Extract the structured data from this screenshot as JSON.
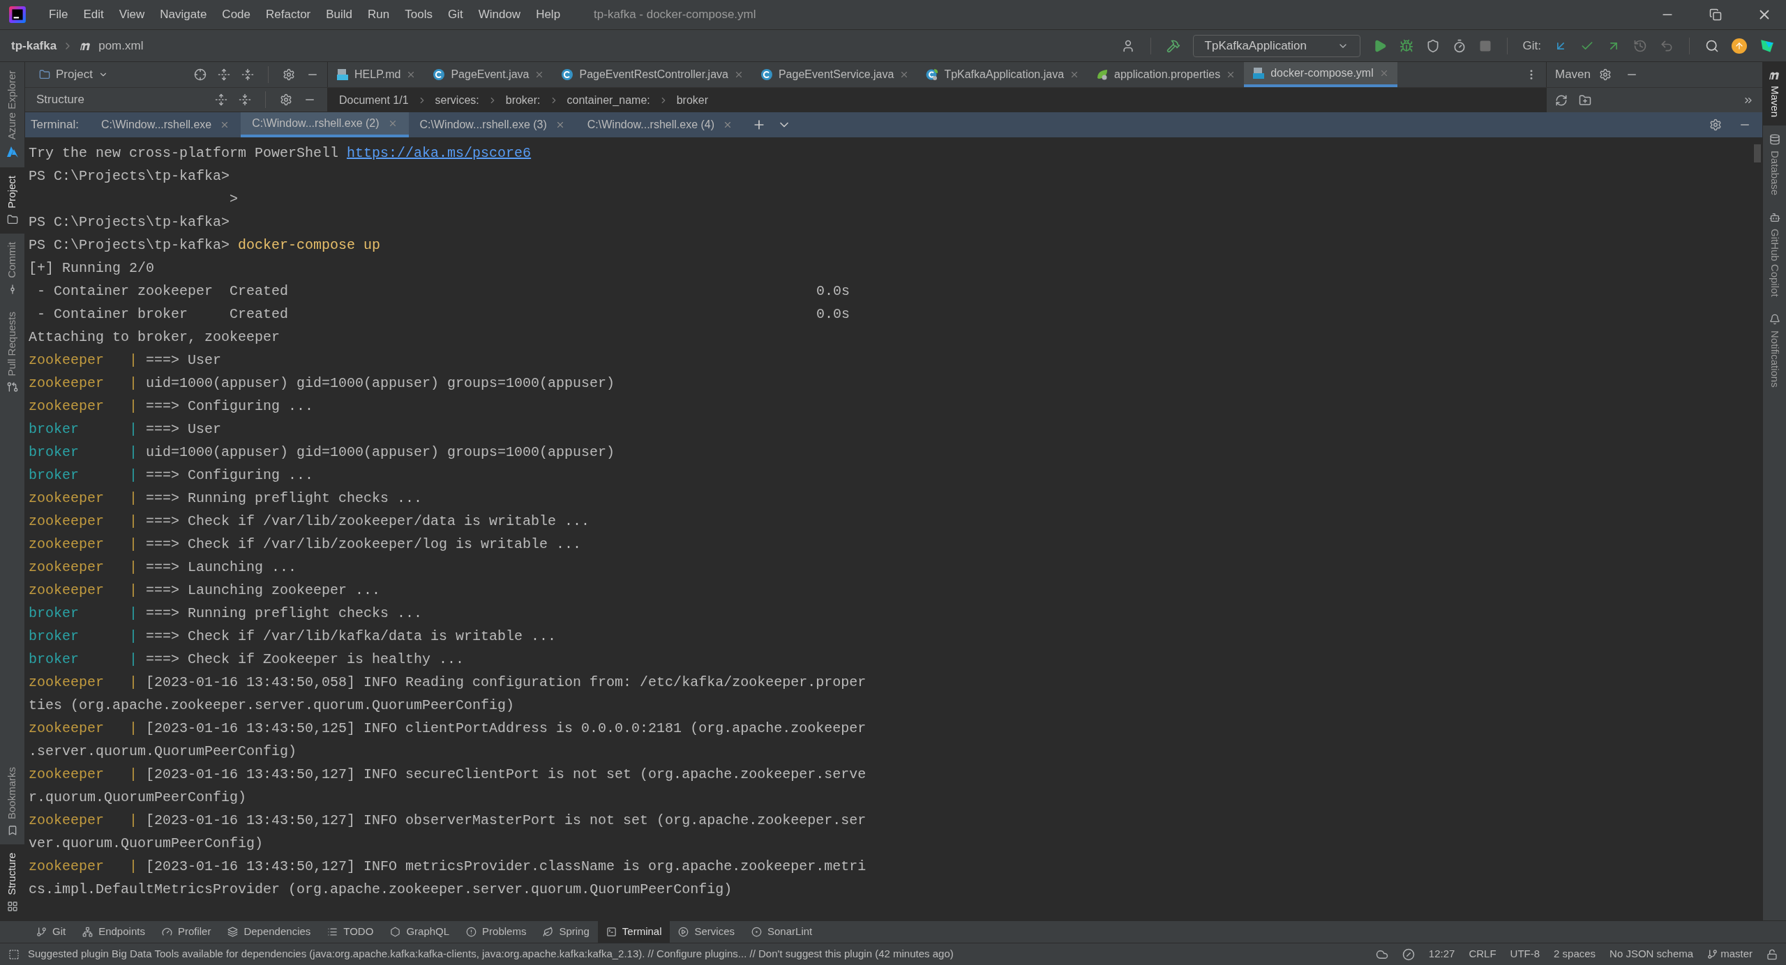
{
  "title_bar": {
    "menus": [
      "File",
      "Edit",
      "View",
      "Navigate",
      "Code",
      "Refactor",
      "Build",
      "Run",
      "Tools",
      "Git",
      "Window",
      "Help"
    ],
    "title": "tp-kafka - docker-compose.yml"
  },
  "nav_bar": {
    "project": "tp-kafka",
    "file": "pom.xml",
    "run_config": "TpKafkaApplication",
    "git_label": "Git:"
  },
  "left_panel": {
    "project_label": "Project",
    "structure_label": "Structure"
  },
  "editor_tabs": [
    {
      "label": "HELP.md",
      "kind": "markdown",
      "selected": false
    },
    {
      "label": "PageEvent.java",
      "kind": "class",
      "selected": false
    },
    {
      "label": "PageEventRestController.java",
      "kind": "class",
      "selected": false
    },
    {
      "label": "PageEventService.java",
      "kind": "class",
      "selected": false
    },
    {
      "label": "TpKafkaApplication.java",
      "kind": "application",
      "selected": false
    },
    {
      "label": "application.properties",
      "kind": "properties",
      "selected": false
    },
    {
      "label": "docker-compose.yml",
      "kind": "compose",
      "selected": true
    }
  ],
  "breadcrumbs": [
    "Document 1/1",
    "services:",
    "broker:",
    "container_name:",
    "broker"
  ],
  "maven": {
    "label": "Maven"
  },
  "terminal": {
    "label": "Terminal:",
    "tabs": [
      {
        "label": "C:\\Window...rshell.exe",
        "selected": false
      },
      {
        "label": "C:\\Window...rshell.exe (2)",
        "selected": true
      },
      {
        "label": "C:\\Window...rshell.exe (3)",
        "selected": false
      },
      {
        "label": "C:\\Window...rshell.exe (4)",
        "selected": false
      }
    ],
    "lines": [
      {
        "kind": "link",
        "text": "Try the new cross-platform PowerShell ",
        "link": "https://aka.ms/pscore6"
      },
      {
        "kind": "plain",
        "text": "PS C:\\Projects\\tp-kafka>"
      },
      {
        "kind": "indent",
        "text": ">"
      },
      {
        "kind": "plain",
        "text": "PS C:\\Projects\\tp-kafka>"
      },
      {
        "kind": "command",
        "text": "PS C:\\Projects\\tp-kafka> ",
        "command": "docker-compose up"
      },
      {
        "kind": "plain",
        "text": "[+] Running 2/0"
      },
      {
        "kind": "status",
        "text": "- Container zookeeper",
        "status": "Created",
        "time": "0.0s"
      },
      {
        "kind": "status",
        "text": "- Container broker",
        "status": "Created",
        "time": "0.0s"
      },
      {
        "kind": "plain",
        "text": "Attaching to broker, zookeeper"
      },
      {
        "kind": "log",
        "service": "zookeeper",
        "color": "#c29b3f",
        "sep": "|",
        "text": "===> User"
      },
      {
        "kind": "log",
        "service": "zookeeper",
        "color": "#c29b3f",
        "sep": "|",
        "text": "uid=1000(appuser) gid=1000(appuser) groups=1000(appuser)"
      },
      {
        "kind": "log",
        "service": "zookeeper",
        "color": "#c29b3f",
        "sep": "|",
        "text": "===> Configuring ..."
      },
      {
        "kind": "log",
        "service": "broker",
        "color": "#2aa3a6",
        "sep": "|",
        "text": "===> User"
      },
      {
        "kind": "log",
        "service": "broker",
        "color": "#2aa3a6",
        "sep": "|",
        "text": "uid=1000(appuser) gid=1000(appuser) groups=1000(appuser)"
      },
      {
        "kind": "log",
        "service": "broker",
        "color": "#2aa3a6",
        "sep": "|",
        "text": "===> Configuring ..."
      },
      {
        "kind": "log",
        "service": "zookeeper",
        "color": "#c29b3f",
        "sep": "|",
        "text": "===> Running preflight checks ..."
      },
      {
        "kind": "log",
        "service": "zookeeper",
        "color": "#c29b3f",
        "sep": "|",
        "text": "===> Check if /var/lib/zookeeper/data is writable ..."
      },
      {
        "kind": "log",
        "service": "zookeeper",
        "color": "#c29b3f",
        "sep": "|",
        "text": "===> Check if /var/lib/zookeeper/log is writable ..."
      },
      {
        "kind": "log",
        "service": "zookeeper",
        "color": "#c29b3f",
        "sep": "|",
        "text": "===> Launching ..."
      },
      {
        "kind": "log",
        "service": "zookeeper",
        "color": "#c29b3f",
        "sep": "|",
        "text": "===> Launching zookeeper ..."
      },
      {
        "kind": "log",
        "service": "broker",
        "color": "#2aa3a6",
        "sep": "|",
        "text": "===> Running preflight checks ..."
      },
      {
        "kind": "log",
        "service": "broker",
        "color": "#2aa3a6",
        "sep": "|",
        "text": "===> Check if /var/lib/kafka/data is writable ..."
      },
      {
        "kind": "log",
        "service": "broker",
        "color": "#2aa3a6",
        "sep": "|",
        "text": "===> Check if Zookeeper is healthy ..."
      },
      {
        "kind": "log",
        "service": "zookeeper",
        "color": "#c29b3f",
        "sep": "|",
        "text": "[2023-01-16 13:43:50,058] INFO Reading configuration from: /etc/kafka/zookeeper.proper"
      },
      {
        "kind": "plain",
        "text": "ties (org.apache.zookeeper.server.quorum.QuorumPeerConfig)"
      },
      {
        "kind": "log",
        "service": "zookeeper",
        "color": "#c29b3f",
        "sep": "|",
        "text": "[2023-01-16 13:43:50,125] INFO clientPortAddress is 0.0.0.0:2181 (org.apache.zookeeper"
      },
      {
        "kind": "plain",
        "text": ".server.quorum.QuorumPeerConfig)"
      },
      {
        "kind": "log",
        "service": "zookeeper",
        "color": "#c29b3f",
        "sep": "|",
        "text": "[2023-01-16 13:43:50,127] INFO secureClientPort is not set (org.apache.zookeeper.serve"
      },
      {
        "kind": "plain",
        "text": "r.quorum.QuorumPeerConfig)"
      },
      {
        "kind": "log",
        "service": "zookeeper",
        "color": "#c29b3f",
        "sep": "|",
        "text": "[2023-01-16 13:43:50,127] INFO observerMasterPort is not set (org.apache.zookeeper.ser"
      },
      {
        "kind": "plain",
        "text": "ver.quorum.QuorumPeerConfig)"
      },
      {
        "kind": "log",
        "service": "zookeeper",
        "color": "#c29b3f",
        "sep": "|",
        "text": "[2023-01-16 13:43:50,127] INFO metricsProvider.className is org.apache.zookeeper.metri"
      },
      {
        "kind": "plain",
        "text": "cs.impl.DefaultMetricsProvider (org.apache.zookeeper.server.quorum.QuorumPeerConfig)"
      }
    ]
  },
  "left_strip_top": [
    {
      "label": "Azure Explorer",
      "kind": "azure",
      "selected": false
    },
    {
      "label": "Project",
      "kind": "project",
      "selected": true
    },
    {
      "label": "Commit",
      "kind": "commit",
      "selected": false
    },
    {
      "label": "Pull Requests",
      "kind": "pull",
      "selected": false
    }
  ],
  "left_strip_bottom": [
    {
      "label": "Bookmarks",
      "kind": "bookmarks",
      "selected": false
    },
    {
      "label": "Structure",
      "kind": "structure",
      "selected": true
    }
  ],
  "right_strip": [
    {
      "label": "Maven",
      "kind": "maven",
      "selected": true
    },
    {
      "label": "Database",
      "kind": "database",
      "selected": false
    },
    {
      "label": "GitHub Copilot",
      "kind": "copilot",
      "selected": false
    },
    {
      "label": "Notifications",
      "kind": "notifications",
      "selected": false
    }
  ],
  "tool_bar": [
    {
      "label": "Git",
      "kind": "git",
      "selected": false
    },
    {
      "label": "Endpoints",
      "kind": "endpoints",
      "selected": false
    },
    {
      "label": "Profiler",
      "kind": "profiler",
      "selected": false
    },
    {
      "label": "Dependencies",
      "kind": "dependencies",
      "selected": false
    },
    {
      "label": "TODO",
      "kind": "todo",
      "selected": false
    },
    {
      "label": "GraphQL",
      "kind": "graphql",
      "selected": false
    },
    {
      "label": "Problems",
      "kind": "problems",
      "selected": false
    },
    {
      "label": "Spring",
      "kind": "spring",
      "selected": false
    },
    {
      "label": "Terminal",
      "kind": "terminal",
      "selected": true
    },
    {
      "label": "Services",
      "kind": "services",
      "selected": false
    },
    {
      "label": "SonarLint",
      "kind": "sonarlint",
      "selected": false
    }
  ],
  "status_bar": {
    "message": "Suggested plugin Big Data Tools available for dependencies (java:org.apache.kafka:kafka-clients, java:org.apache.kafka:kafka_2.13). // Configure plugins... // Don't suggest this plugin (42 minutes ago)",
    "position": "12:27",
    "line_ending": "CRLF",
    "encoding": "UTF-8",
    "indent": "2 spaces",
    "schema": "No JSON schema",
    "branch": "master"
  }
}
